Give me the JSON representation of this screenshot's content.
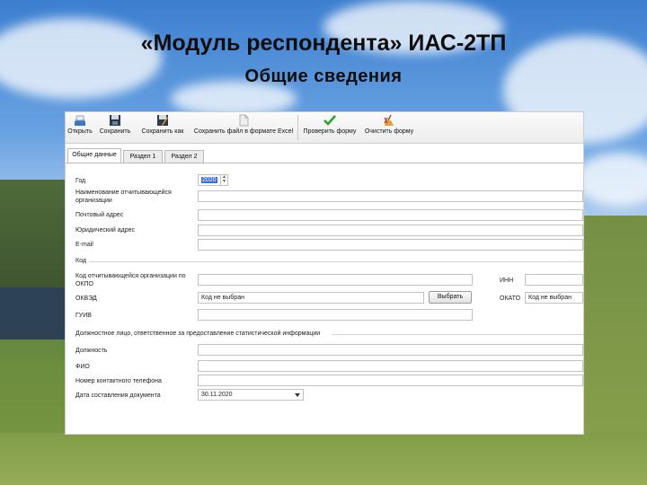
{
  "slide": {
    "title": "«Модуль респондента» ИАС-2ТП",
    "subtitle": "Общие сведения"
  },
  "toolbar": {
    "open": "Открыть",
    "save": "Сохранить",
    "save_as": "Сохранить как",
    "save_excel": "Сохранить файл в формате Excel",
    "check": "Проверить форму",
    "clear": "Очистить форму"
  },
  "tabs": {
    "general": "Общие данные",
    "section1": "Раздел 1",
    "section2": "Раздел 2"
  },
  "form": {
    "year_label": "Год",
    "year_value": "2020",
    "org_name_label": "Наименование отчитывающейся организации",
    "postal_label": "Почтовый адрес",
    "legal_label": "Юридический адрес",
    "email_label": "E-mail",
    "code_section": "Код",
    "okpo_label": "Код отчитывающейся организации по ОКПО",
    "inn_label": "ИНН",
    "okved_label": "ОКВЭД",
    "okved_value": "Код не выбран",
    "choose_button": "Выбрать",
    "okato_label": "ОКАТО",
    "okato_value": "Код не выбран",
    "guiv_label": "ГУИВ",
    "official_section": "Должностное лицо, ответственное за предоставление статистической информации",
    "position_label": "Должность",
    "fio_label": "ФИО",
    "phone_label": "Номер контактного телефона",
    "date_label": "Дата составления документа",
    "date_value": "30.11.2020"
  },
  "colors": {
    "check_icon": "#2aa52a",
    "clear_icon": "#c0392b",
    "selection": "#3a6fd8"
  }
}
